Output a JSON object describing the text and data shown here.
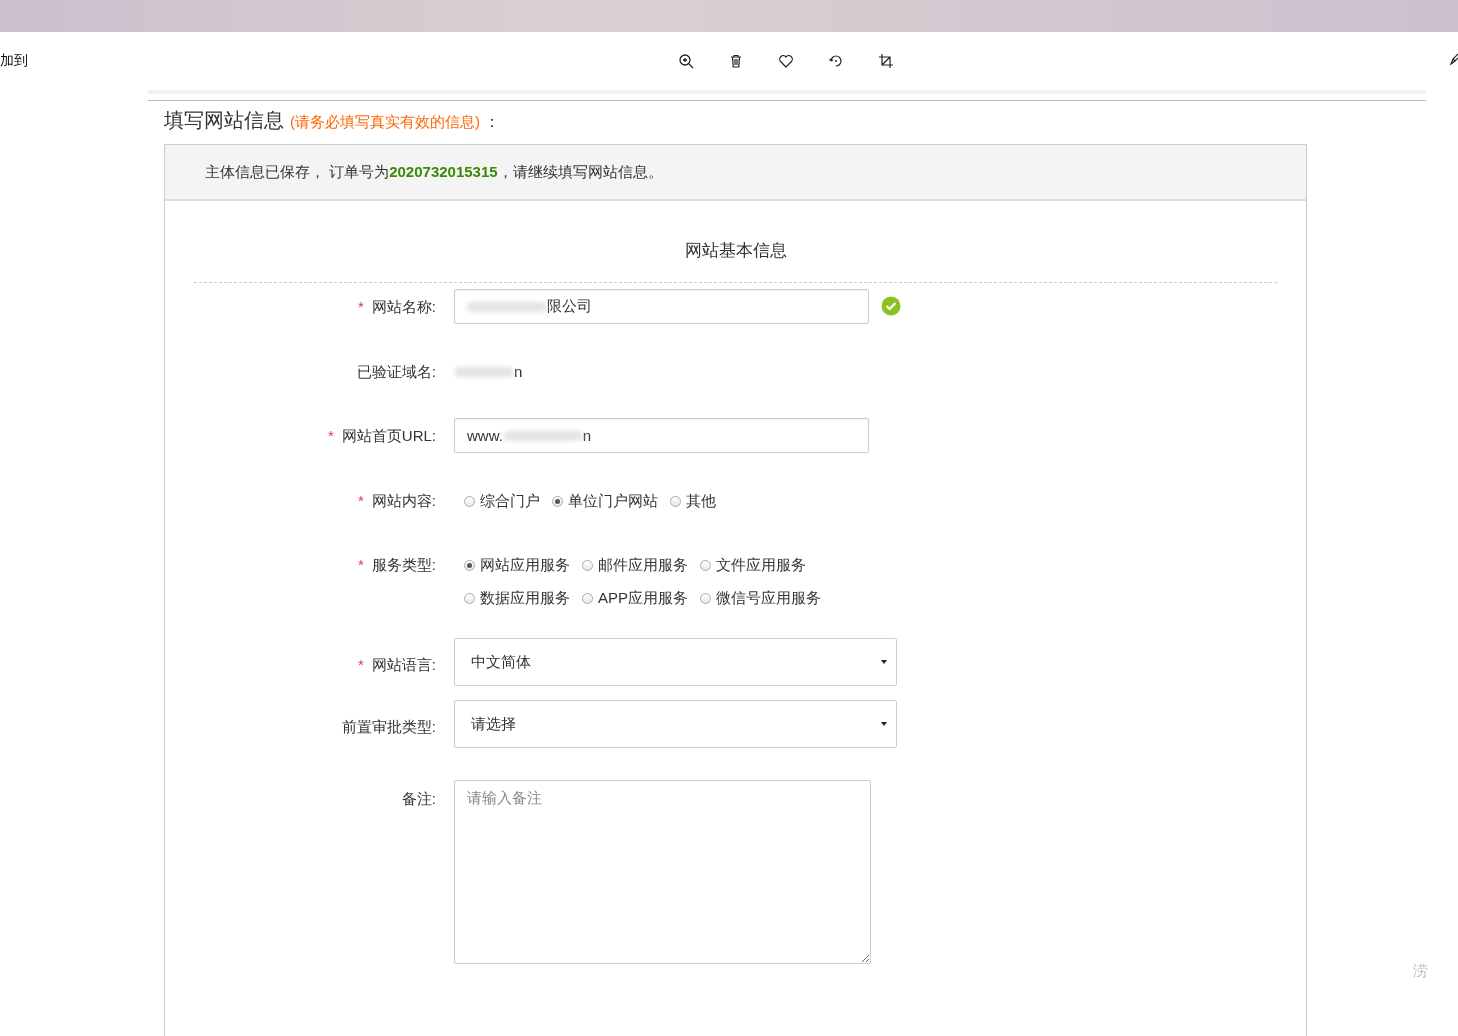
{
  "viewer": {
    "left_text": "加到",
    "tools": [
      {
        "kind": "zoom"
      },
      {
        "kind": "delete"
      },
      {
        "kind": "favorite"
      },
      {
        "kind": "rotate"
      },
      {
        "kind": "crop"
      }
    ]
  },
  "heading": {
    "title": "填写网站信息",
    "note": "(请务必填写真实有效的信息)",
    "colon": "："
  },
  "notice": {
    "before": "主体信息已保存， 订单号为",
    "order": "2020732015315",
    "after": "，请继续填写网站信息。"
  },
  "section_title": "网站基本信息",
  "fields": [
    {
      "kind": "text",
      "label": "网站名称:",
      "required_mark": "*",
      "value_tail": "限公司",
      "valid": true
    },
    {
      "kind": "static",
      "label": "已验证域名:",
      "value_tail": "n"
    },
    {
      "kind": "text",
      "label": "网站首页URL:",
      "required_mark": "*",
      "value": "www.",
      "value_tail": "n"
    },
    {
      "kind": "radio",
      "label": "网站内容:",
      "required_mark": "*",
      "options": [
        {
          "label": "综合门户",
          "selected": false
        },
        {
          "label": "单位门户网站",
          "selected": true
        },
        {
          "label": "其他",
          "selected": false
        }
      ]
    },
    {
      "kind": "radio",
      "label": "服务类型:",
      "required_mark": "*",
      "options": [
        {
          "label": "网站应用服务",
          "selected": true
        },
        {
          "label": "邮件应用服务",
          "selected": false
        },
        {
          "label": "文件应用服务",
          "selected": false
        },
        {
          "label": "数据应用服务",
          "selected": false
        },
        {
          "label": "APP应用服务",
          "selected": false
        },
        {
          "label": "微信号应用服务",
          "selected": false
        }
      ]
    },
    {
      "kind": "select",
      "label": "网站语言:",
      "required_mark": "*",
      "value": "中文简体"
    },
    {
      "kind": "select",
      "label": "前置审批类型:",
      "value": "请选择"
    },
    {
      "kind": "textarea",
      "label": "备注:",
      "placeholder": "请输入备注"
    }
  ],
  "side_text": "涝"
}
